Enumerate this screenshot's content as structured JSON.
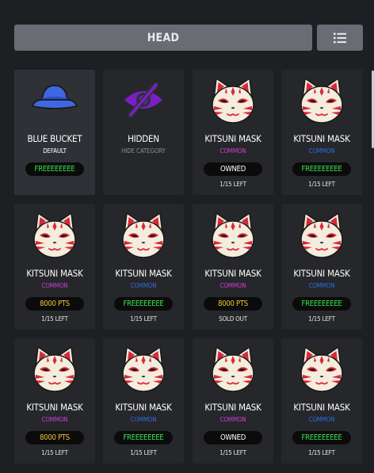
{
  "header": {
    "title": "HEAD",
    "menu_icon": "list-icon"
  },
  "colors": {
    "common": "#d33bd6",
    "default_sub": "#ffffff",
    "blue_sub": "#2f6be0",
    "free": "#35e54a",
    "pts": "#f0c232",
    "owned": "#ffffff",
    "hidden_sub": "#8a8d93"
  },
  "items": [
    {
      "name": "BLUE BUCKET",
      "sub": "DEFAULT",
      "sub_color": "#ffffff",
      "tag": "FREEEEEEEE",
      "tag_color": "#35e54a",
      "left": "",
      "icon": "blue-bucket-hat-icon",
      "selected": true
    },
    {
      "name": "HIDDEN",
      "sub": "HIDE CATEGORY",
      "sub_color": "#8a8d93",
      "tag": "",
      "tag_color": "",
      "left": "",
      "icon": "eye-slash-icon",
      "selected": false
    },
    {
      "name": "KITSUNI MASK",
      "sub": "COMMON",
      "sub_color": "#d33bd6",
      "tag": "OWNED",
      "tag_color": "#ffffff",
      "left": "1/15 LEFT",
      "icon": "kitsune-mask-icon",
      "selected": false
    },
    {
      "name": "KITSUNI MASK",
      "sub": "COMMON",
      "sub_color": "#2f6be0",
      "tag": "FREEEEEEEE",
      "tag_color": "#35e54a",
      "left": "1/15 LEFT",
      "icon": "kitsune-mask-icon",
      "selected": false
    },
    {
      "name": "KITSUNI MASK",
      "sub": "COMMON",
      "sub_color": "#d33bd6",
      "tag": "8000 PTS",
      "tag_color": "#f0c232",
      "left": "1/15 LEFT",
      "icon": "kitsune-mask-icon",
      "selected": false
    },
    {
      "name": "KITSUNI MASK",
      "sub": "COMMON",
      "sub_color": "#2f6be0",
      "tag": "FREEEEEEEE",
      "tag_color": "#35e54a",
      "left": "1/15 LEFT",
      "icon": "kitsune-mask-icon",
      "selected": false
    },
    {
      "name": "KITSUNI MASK",
      "sub": "COMMON",
      "sub_color": "#d33bd6",
      "tag": "8000 PTS",
      "tag_color": "#f0c232",
      "left": "SOLD OUT",
      "icon": "kitsune-mask-icon",
      "selected": false
    },
    {
      "name": "KITSUNI MASK",
      "sub": "COMMON",
      "sub_color": "#2f6be0",
      "tag": "FREEEEEEEE",
      "tag_color": "#35e54a",
      "left": "1/15 LEFT",
      "icon": "kitsune-mask-icon",
      "selected": false
    },
    {
      "name": "KITSUNI MASK",
      "sub": "COMMON",
      "sub_color": "#d33bd6",
      "tag": "8000 PTS",
      "tag_color": "#f0c232",
      "left": "1/15 LEFT",
      "icon": "kitsune-mask-icon",
      "selected": false
    },
    {
      "name": "KITSUNI MASK",
      "sub": "COMMON",
      "sub_color": "#2f6be0",
      "tag": "FREEEEEEEE",
      "tag_color": "#35e54a",
      "left": "1/15 LEFT",
      "icon": "kitsune-mask-icon",
      "selected": false
    },
    {
      "name": "KITSUNI MASK",
      "sub": "COMMON",
      "sub_color": "#d33bd6",
      "tag": "OWNED",
      "tag_color": "#ffffff",
      "left": "1/15 LEFT",
      "icon": "kitsune-mask-icon",
      "selected": false
    },
    {
      "name": "KITSUNI MASK",
      "sub": "COMMON",
      "sub_color": "#2f6be0",
      "tag": "FREEEEEEEE",
      "tag_color": "#35e54a",
      "left": "1/15 LEFT",
      "icon": "kitsune-mask-icon",
      "selected": false
    }
  ]
}
